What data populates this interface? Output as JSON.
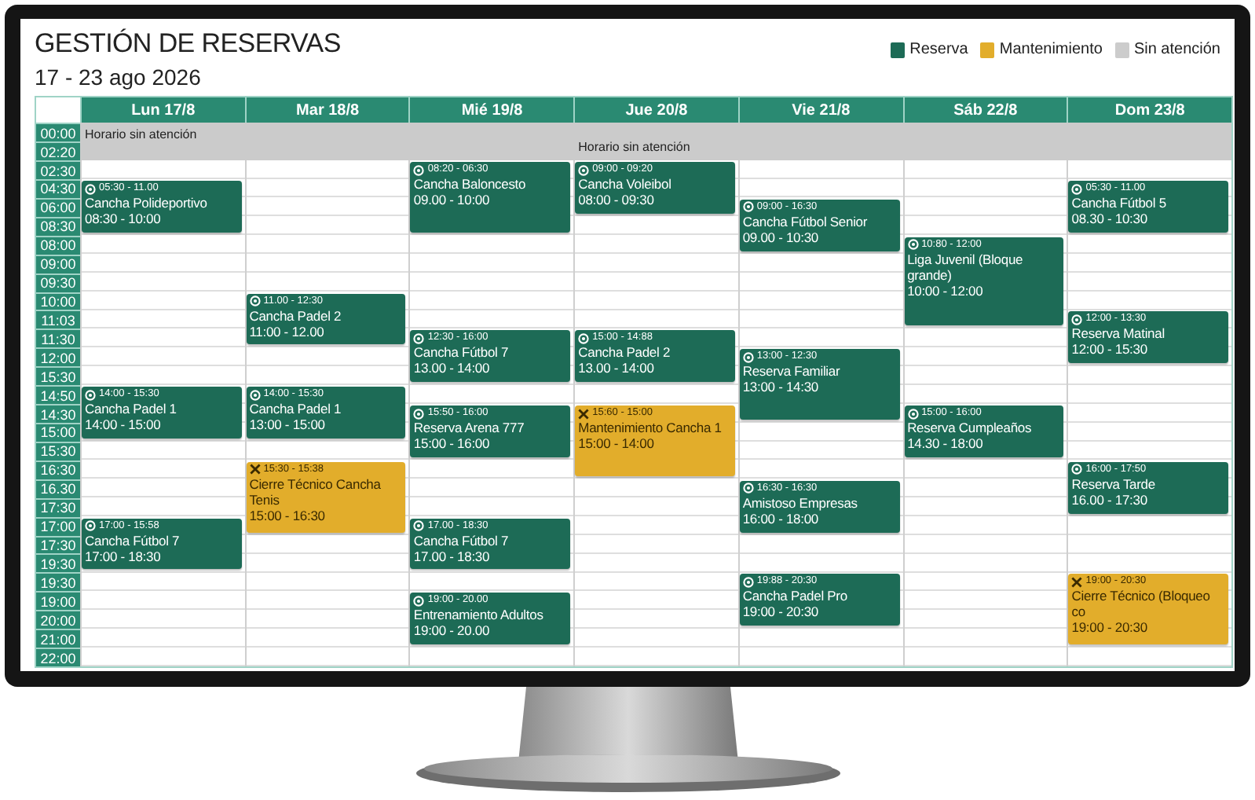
{
  "title": "GESTIÓN DE RESERVAS",
  "date_range": "17 - 23 ago 2026",
  "legend": [
    {
      "label": "Reserva",
      "color": "#1d6b56"
    },
    {
      "label": "Mantenimiento",
      "color": "#e2ad2b"
    },
    {
      "label": "Sin atención",
      "color": "#cccccc"
    }
  ],
  "time_slots": [
    "00:00",
    "02:20",
    "02:30",
    "04:30",
    "06:00",
    "08:30",
    "08:00",
    "09:00",
    "09:30",
    "10:00",
    "11:03",
    "11:30",
    "12:00",
    "15:30",
    "14:50",
    "14:30",
    "15:00",
    "15:30",
    "16:30",
    "16.30",
    "17:30",
    "17:00",
    "17:30",
    "19:30",
    "19:30",
    "19:00",
    "20:00",
    "21:00",
    "22:00"
  ],
  "days": [
    {
      "label": "Lun 17/8",
      "closed_label": "Horario sin atención",
      "events": [
        {
          "kind": "reserva",
          "time": "05:30 - 11.00",
          "name": "Cancha Polideportivo",
          "range": "08:30 - 10:00"
        },
        {
          "kind": "reserva",
          "time": "14:00 - 15:30",
          "name": "Cancha Padel 1",
          "range": "14:00 - 15:00"
        },
        {
          "kind": "reserva",
          "time": "17:00 - 15:58",
          "name": "Cancha Fútbol 7",
          "range": "17:00 - 18:30"
        }
      ]
    },
    {
      "label": "Mar 18/8",
      "events": [
        {
          "kind": "reserva",
          "time": "11.00 - 12:30",
          "name": "Cancha Padel 2",
          "range": "11:00 - 12.00"
        },
        {
          "kind": "reserva",
          "time": "14:00 - 15:30",
          "name": "Cancha Padel 1",
          "range": "13:00 - 15:00"
        },
        {
          "kind": "mantenimiento",
          "time": "15:30 - 15:38",
          "name": "Cierre Técnico Cancha Tenis",
          "range": "15:00 - 16:30"
        }
      ]
    },
    {
      "label": "Mié 19/8",
      "events": [
        {
          "kind": "reserva",
          "time": "08:20 - 06:30",
          "name": "Cancha Baloncesto",
          "range": "09.00 - 10:00"
        },
        {
          "kind": "reserva",
          "time": "12:30 - 16:00",
          "name": "Cancha Fútbol 7",
          "range": "13.00 - 14:00"
        },
        {
          "kind": "reserva",
          "time": "15:50 - 16:00",
          "name": "Reserva Arena 777",
          "range": "15:00 - 16:00"
        },
        {
          "kind": "reserva",
          "time": "17.00 - 18:30",
          "name": "Cancha Fútbol 7",
          "range": "17.00 - 18:30"
        },
        {
          "kind": "reserva",
          "time": "19:00 - 20.00",
          "name": "Entrenamiento Adultos",
          "range": "19:00 - 20.00"
        }
      ]
    },
    {
      "label": "Jue 20/8",
      "closed_label": "Horario sin atención",
      "events": [
        {
          "kind": "reserva",
          "time": "09:00 - 09:20",
          "name": "Cancha Voleibol",
          "range": "08:00 - 09:30"
        },
        {
          "kind": "reserva",
          "time": "15:00 - 14:88",
          "name": "Cancha Padel 2",
          "range": "13.00 - 14:00"
        },
        {
          "kind": "mantenimiento",
          "time": "15:60 - 15:00",
          "name": "Mantenimiento Cancha 1",
          "range": "15:00 - 14:00"
        }
      ]
    },
    {
      "label": "Vie 21/8",
      "events": [
        {
          "kind": "reserva",
          "time": "09:00 - 16:30",
          "name": "Cancha Fútbol Senior",
          "range": "09.00 - 10:30"
        },
        {
          "kind": "reserva",
          "time": "13:00 - 12:30",
          "name": "Reserva Familiar",
          "range": "13:00 - 14:30"
        },
        {
          "kind": "reserva",
          "time": "16:30 - 16:30",
          "name": "Amistoso Empresas",
          "range": "16:00 - 18:00"
        },
        {
          "kind": "reserva",
          "time": "19:88 - 20:30",
          "name": "Cancha Padel Pro",
          "range": "19:00 - 20:30"
        }
      ]
    },
    {
      "label": "Sáb 22/8",
      "events": [
        {
          "kind": "reserva",
          "time": "10:80 - 12:00",
          "name": "Liga Juvenil (Bloque grande)",
          "range": "10:00 - 12:00"
        },
        {
          "kind": "reserva",
          "time": "15:00 - 16:00",
          "name": "Reserva Cumpleaños",
          "range": "14.30 - 18:00"
        }
      ]
    },
    {
      "label": "Dom 23/8",
      "events": [
        {
          "kind": "reserva",
          "time": "05:30 - 11.00",
          "name": "Cancha Fútbol 5",
          "range": "08.30 - 10:30"
        },
        {
          "kind": "reserva",
          "time": "12:00 - 13:30",
          "name": "Reserva Matinal",
          "range": "12:00 - 15:30"
        },
        {
          "kind": "reserva",
          "time": "16:00 - 17:50",
          "name": "Reserva Tarde",
          "range": "16.00 - 17:30"
        },
        {
          "kind": "mantenimiento",
          "time": "19:00 - 20:30",
          "name": "Cierre Técnico (Bloqueo co",
          "range": "19:00 - 20:30"
        }
      ]
    }
  ]
}
